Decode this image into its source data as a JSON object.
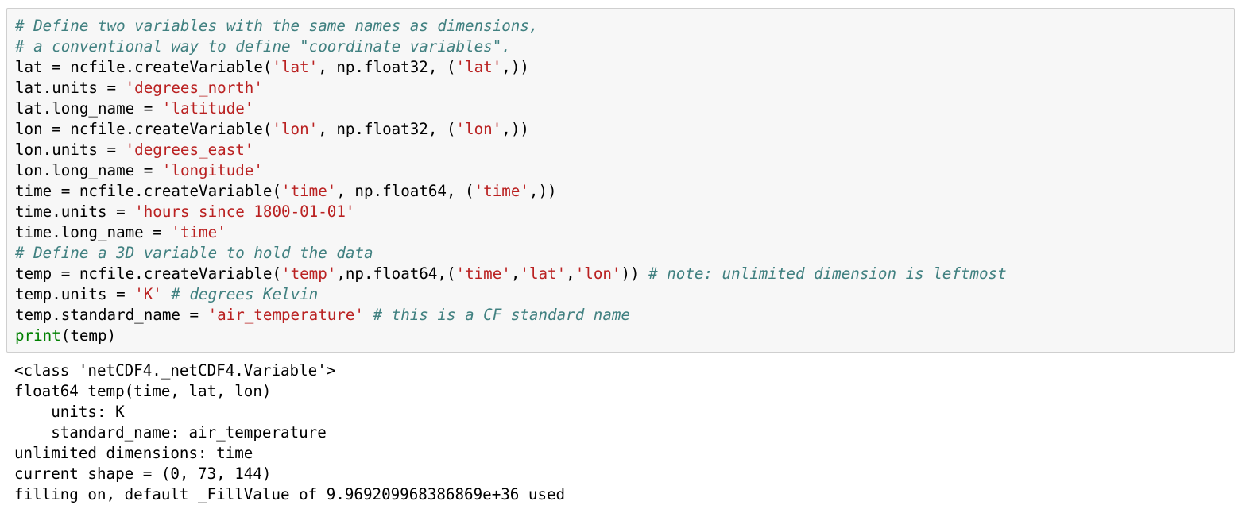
{
  "input_cell": {
    "lines": [
      [
        {
          "t": "c",
          "v": "# Define two variables with the same names as dimensions,"
        }
      ],
      [
        {
          "t": "c",
          "v": "# a conventional way to define \"coordinate variables\"."
        }
      ],
      [
        {
          "t": "n",
          "v": "lat = ncfile.createVariable("
        },
        {
          "t": "s",
          "v": "'lat'"
        },
        {
          "t": "n",
          "v": ", np.float32, ("
        },
        {
          "t": "s",
          "v": "'lat'"
        },
        {
          "t": "n",
          "v": ",))"
        }
      ],
      [
        {
          "t": "n",
          "v": "lat.units = "
        },
        {
          "t": "s",
          "v": "'degrees_north'"
        }
      ],
      [
        {
          "t": "n",
          "v": "lat.long_name = "
        },
        {
          "t": "s",
          "v": "'latitude'"
        }
      ],
      [
        {
          "t": "n",
          "v": "lon = ncfile.createVariable("
        },
        {
          "t": "s",
          "v": "'lon'"
        },
        {
          "t": "n",
          "v": ", np.float32, ("
        },
        {
          "t": "s",
          "v": "'lon'"
        },
        {
          "t": "n",
          "v": ",))"
        }
      ],
      [
        {
          "t": "n",
          "v": "lon.units = "
        },
        {
          "t": "s",
          "v": "'degrees_east'"
        }
      ],
      [
        {
          "t": "n",
          "v": "lon.long_name = "
        },
        {
          "t": "s",
          "v": "'longitude'"
        }
      ],
      [
        {
          "t": "n",
          "v": "time = ncfile.createVariable("
        },
        {
          "t": "s",
          "v": "'time'"
        },
        {
          "t": "n",
          "v": ", np.float64, ("
        },
        {
          "t": "s",
          "v": "'time'"
        },
        {
          "t": "n",
          "v": ",))"
        }
      ],
      [
        {
          "t": "n",
          "v": "time.units = "
        },
        {
          "t": "s",
          "v": "'hours since 1800-01-01'"
        }
      ],
      [
        {
          "t": "n",
          "v": "time.long_name = "
        },
        {
          "t": "s",
          "v": "'time'"
        }
      ],
      [
        {
          "t": "c",
          "v": "# Define a 3D variable to hold the data"
        }
      ],
      [
        {
          "t": "n",
          "v": "temp = ncfile.createVariable("
        },
        {
          "t": "s",
          "v": "'temp'"
        },
        {
          "t": "n",
          "v": ",np.float64,("
        },
        {
          "t": "s",
          "v": "'time'"
        },
        {
          "t": "n",
          "v": ","
        },
        {
          "t": "s",
          "v": "'lat'"
        },
        {
          "t": "n",
          "v": ","
        },
        {
          "t": "s",
          "v": "'lon'"
        },
        {
          "t": "n",
          "v": ")) "
        },
        {
          "t": "c",
          "v": "# note: unlimited dimension is leftmost"
        }
      ],
      [
        {
          "t": "n",
          "v": "temp.units = "
        },
        {
          "t": "s",
          "v": "'K'"
        },
        {
          "t": "n",
          "v": " "
        },
        {
          "t": "c",
          "v": "# degrees Kelvin"
        }
      ],
      [
        {
          "t": "n",
          "v": "temp.standard_name = "
        },
        {
          "t": "s",
          "v": "'air_temperature'"
        },
        {
          "t": "n",
          "v": " "
        },
        {
          "t": "c",
          "v": "# this is a CF standard name"
        }
      ],
      [
        {
          "t": "b",
          "v": "print"
        },
        {
          "t": "n",
          "v": "(temp)"
        }
      ]
    ]
  },
  "output_cell": {
    "lines": [
      "<class 'netCDF4._netCDF4.Variable'>",
      "float64 temp(time, lat, lon)",
      "    units: K",
      "    standard_name: air_temperature",
      "unlimited dimensions: time",
      "current shape = (0, 73, 144)",
      "filling on, default _FillValue of 9.969209968386869e+36 used"
    ]
  },
  "colors": {
    "cell_background": "#f7f7f7",
    "cell_border": "#cfcfcf",
    "comment": "#408080",
    "string": "#ba2121",
    "builtin": "#008000",
    "text": "#000000"
  }
}
